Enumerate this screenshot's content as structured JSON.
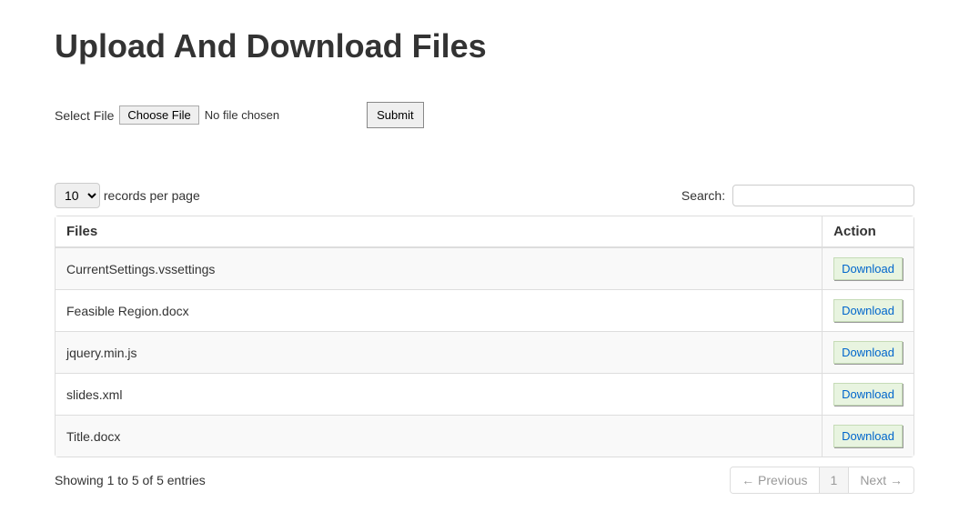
{
  "header": {
    "title": "Upload And Download Files"
  },
  "upload": {
    "select_file_label": "Select File",
    "choose_file_label": "Choose File",
    "no_file_text": "No file chosen",
    "submit_label": "Submit"
  },
  "table": {
    "length_value": "10",
    "records_per_page_text": "records per page",
    "search_label": "Search:",
    "search_value": "",
    "columns": {
      "files": "Files",
      "action": "Action"
    },
    "download_label": "Download",
    "rows": [
      {
        "name": "CurrentSettings.vssettings"
      },
      {
        "name": "Feasible Region.docx"
      },
      {
        "name": "jquery.min.js"
      },
      {
        "name": "slides.xml"
      },
      {
        "name": "Title.docx"
      }
    ],
    "info_text": "Showing 1 to 5 of 5 entries",
    "pagination": {
      "previous": "← Previous",
      "current": "1",
      "next": "Next →"
    }
  }
}
